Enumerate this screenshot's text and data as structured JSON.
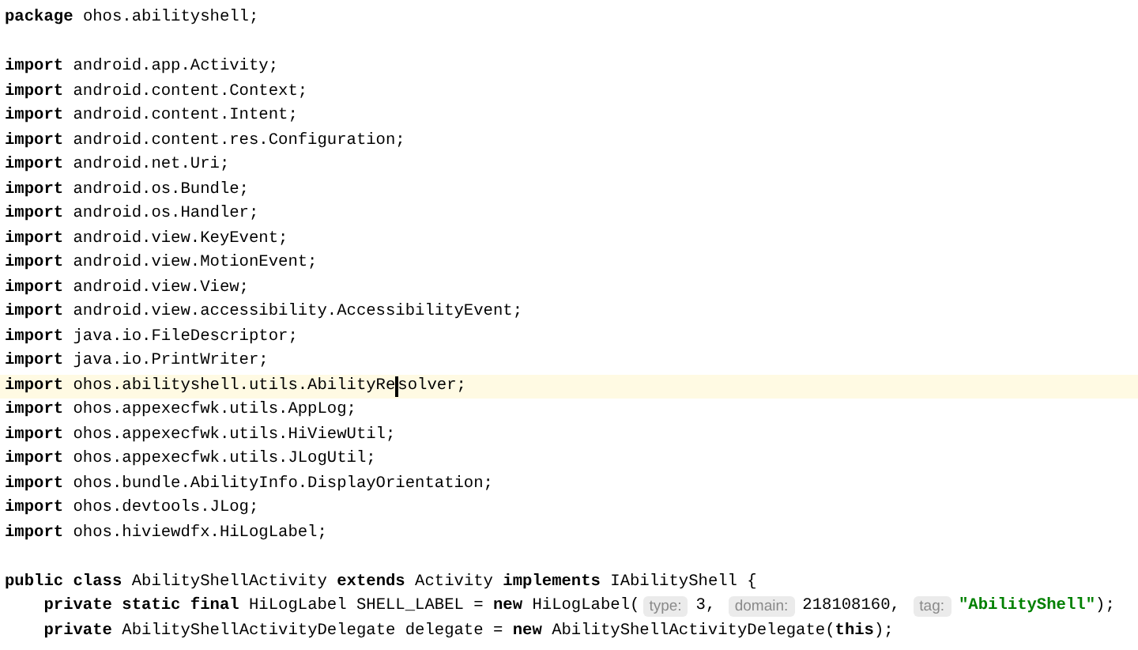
{
  "editor": {
    "lines": [
      {
        "kind": "code",
        "current": false,
        "segments": [
          {
            "kind": "code",
            "text": "**package** ohos.abilityshell;"
          }
        ]
      },
      {
        "kind": "blank",
        "current": false
      },
      {
        "kind": "code",
        "current": false,
        "segments": [
          {
            "kind": "code",
            "text": "**import** android.app.Activity;"
          }
        ]
      },
      {
        "kind": "code",
        "current": false,
        "segments": [
          {
            "kind": "code",
            "text": "**import** android.content.Context;"
          }
        ]
      },
      {
        "kind": "code",
        "current": false,
        "segments": [
          {
            "kind": "code",
            "text": "**import** android.content.Intent;"
          }
        ]
      },
      {
        "kind": "code",
        "current": false,
        "segments": [
          {
            "kind": "code",
            "text": "**import** android.content.res.Configuration;"
          }
        ]
      },
      {
        "kind": "code",
        "current": false,
        "segments": [
          {
            "kind": "code",
            "text": "**import** android.net.Uri;"
          }
        ]
      },
      {
        "kind": "code",
        "current": false,
        "segments": [
          {
            "kind": "code",
            "text": "**import** android.os.Bundle;"
          }
        ]
      },
      {
        "kind": "code",
        "current": false,
        "segments": [
          {
            "kind": "code",
            "text": "**import** android.os.Handler;"
          }
        ]
      },
      {
        "kind": "code",
        "current": false,
        "segments": [
          {
            "kind": "code",
            "text": "**import** android.view.KeyEvent;"
          }
        ]
      },
      {
        "kind": "code",
        "current": false,
        "segments": [
          {
            "kind": "code",
            "text": "**import** android.view.MotionEvent;"
          }
        ]
      },
      {
        "kind": "code",
        "current": false,
        "segments": [
          {
            "kind": "code",
            "text": "**import** android.view.View;"
          }
        ]
      },
      {
        "kind": "code",
        "current": false,
        "segments": [
          {
            "kind": "code",
            "text": "**import** android.view.accessibility.AccessibilityEvent;"
          }
        ]
      },
      {
        "kind": "code",
        "current": false,
        "segments": [
          {
            "kind": "code",
            "text": "**import** java.io.FileDescriptor;"
          }
        ]
      },
      {
        "kind": "code",
        "current": false,
        "segments": [
          {
            "kind": "code",
            "text": "**import** java.io.PrintWriter;"
          }
        ]
      },
      {
        "kind": "code",
        "current": true,
        "segments": [
          {
            "kind": "code",
            "text": "**import** ohos.abilityshell.utils.AbilityRe"
          },
          {
            "kind": "caret"
          },
          {
            "kind": "code",
            "text": "solver;"
          }
        ]
      },
      {
        "kind": "code",
        "current": false,
        "segments": [
          {
            "kind": "code",
            "text": "**import** ohos.appexecfwk.utils.AppLog;"
          }
        ]
      },
      {
        "kind": "code",
        "current": false,
        "segments": [
          {
            "kind": "code",
            "text": "**import** ohos.appexecfwk.utils.HiViewUtil;"
          }
        ]
      },
      {
        "kind": "code",
        "current": false,
        "segments": [
          {
            "kind": "code",
            "text": "**import** ohos.appexecfwk.utils.JLogUtil;"
          }
        ]
      },
      {
        "kind": "code",
        "current": false,
        "segments": [
          {
            "kind": "code",
            "text": "**import** ohos.bundle.AbilityInfo.DisplayOrientation;"
          }
        ]
      },
      {
        "kind": "code",
        "current": false,
        "segments": [
          {
            "kind": "code",
            "text": "**import** ohos.devtools.JLog;"
          }
        ]
      },
      {
        "kind": "code",
        "current": false,
        "segments": [
          {
            "kind": "code",
            "text": "**import** ohos.hiviewdfx.HiLogLabel;"
          }
        ]
      },
      {
        "kind": "blank",
        "current": false
      },
      {
        "kind": "code",
        "current": false,
        "segments": [
          {
            "kind": "code",
            "text": "**public class** AbilityShellActivity **extends** Activity **implements** IAbilityShell {"
          }
        ]
      },
      {
        "kind": "code",
        "current": false,
        "segments": [
          {
            "kind": "code",
            "text": "    **private static final** HiLogLabel SHELL_LABEL = **new** HiLogLabel("
          },
          {
            "kind": "hint",
            "text": "type:"
          },
          {
            "kind": "code",
            "text": "3, "
          },
          {
            "kind": "hint",
            "text": "domain:"
          },
          {
            "kind": "code",
            "text": "218108160, "
          },
          {
            "kind": "hint",
            "text": "tag:"
          },
          {
            "kind": "string",
            "text": "\"AbilityShell\""
          },
          {
            "kind": "code",
            "text": ");"
          }
        ]
      },
      {
        "kind": "code",
        "current": false,
        "segments": [
          {
            "kind": "code",
            "text": "    **private** AbilityShellActivityDelegate delegate = **new** AbilityShellActivityDelegate(**this**);"
          }
        ]
      }
    ]
  }
}
